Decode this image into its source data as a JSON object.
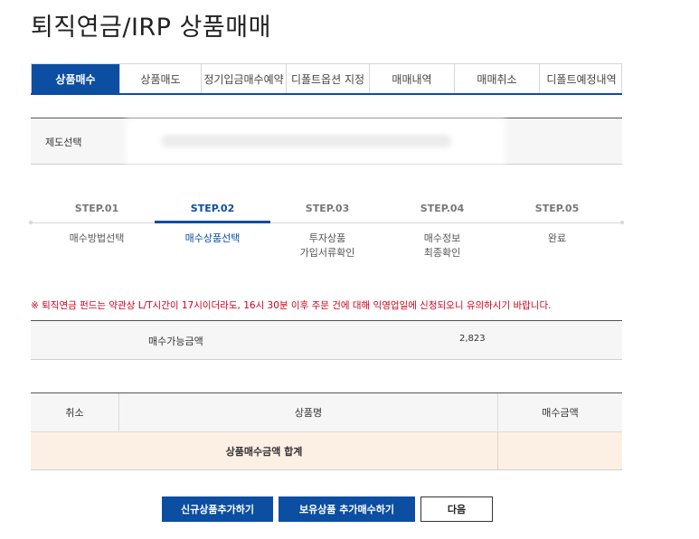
{
  "page": {
    "title": "퇴직연금/IRP 상품매매"
  },
  "tabs": [
    {
      "label": "상품매수",
      "active": true
    },
    {
      "label": "상품매도",
      "active": false
    },
    {
      "label": "정기입금매수예약",
      "active": false
    },
    {
      "label": "디폴트옵션 지정",
      "active": false
    },
    {
      "label": "매매내역",
      "active": false
    },
    {
      "label": "매매취소",
      "active": false
    },
    {
      "label": "디폴트예정내역",
      "active": false
    }
  ],
  "scheme": {
    "label": "제도선택"
  },
  "steps": [
    {
      "num": "STEP.01",
      "line1": "매수방법선택",
      "line2": ""
    },
    {
      "num": "STEP.02",
      "line1": "매수상품선택",
      "line2": "",
      "active": true
    },
    {
      "num": "STEP.03",
      "line1": "투자상품",
      "line2": "가입서류확인"
    },
    {
      "num": "STEP.04",
      "line1": "매수정보",
      "line2": "최종확인"
    },
    {
      "num": "STEP.05",
      "line1": "완료",
      "line2": ""
    }
  ],
  "notice": "※ 퇴직연금 펀드는 약관상 L/T시간이 17시이더라도, 16시 30분 이후 주문 건에 대해 익영업일에 신청되오니 유의하시기 바랍니다.",
  "available": {
    "label": "매수가능금액",
    "value": "2,823"
  },
  "table": {
    "headers": {
      "cancel": "취소",
      "product": "상품명",
      "amount": "매수금액"
    },
    "sum_label": "상품매수금액 합계"
  },
  "buttons": {
    "add_new": "신규상품추가하기",
    "add_held": "보유상품 추가매수하기",
    "next": "다음"
  },
  "colors": {
    "primary": "#0b4ea2",
    "notice": "#d0021b",
    "sum_row": "#fcefe4"
  }
}
